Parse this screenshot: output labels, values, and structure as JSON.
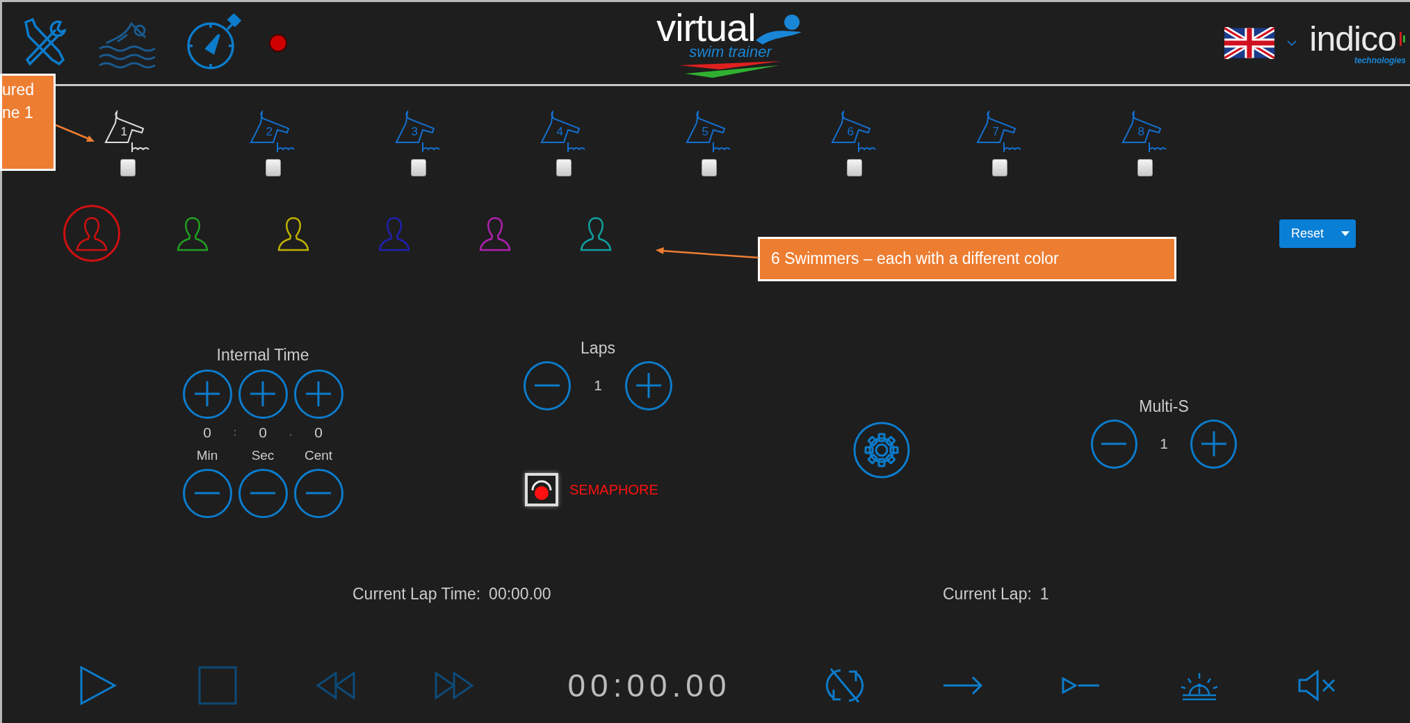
{
  "header": {
    "recording": true,
    "logo": {
      "word": "virtual",
      "tagline": "swim trainer"
    },
    "brand": {
      "name": "indico",
      "sub": "technologies"
    }
  },
  "lanes": [
    {
      "number": "1",
      "selected": true,
      "checked": false
    },
    {
      "number": "2",
      "selected": false,
      "checked": false
    },
    {
      "number": "3",
      "selected": false,
      "checked": false
    },
    {
      "number": "4",
      "selected": false,
      "checked": false
    },
    {
      "number": "5",
      "selected": false,
      "checked": false
    },
    {
      "number": "6",
      "selected": false,
      "checked": false
    },
    {
      "number": "7",
      "selected": false,
      "checked": false
    },
    {
      "number": "8",
      "selected": false,
      "checked": false
    }
  ],
  "swimmers": [
    {
      "color": "#d01010",
      "selected": true
    },
    {
      "color": "#20a020",
      "selected": false
    },
    {
      "color": "#c0b000",
      "selected": false
    },
    {
      "color": "#2020b0",
      "selected": false
    },
    {
      "color": "#b020b0",
      "selected": false
    },
    {
      "color": "#10a0a0",
      "selected": false
    }
  ],
  "reset_button": {
    "label": "Reset"
  },
  "internal_time": {
    "title": "Internal Time",
    "fields": [
      {
        "value": "0",
        "label": "Min"
      },
      {
        "value": "0",
        "label": "Sec"
      },
      {
        "value": "0",
        "label": "Cent"
      }
    ],
    "separators": [
      ":",
      "."
    ]
  },
  "laps": {
    "title": "Laps",
    "value": "1"
  },
  "semaphore": {
    "label": "SEMAPHORE",
    "on": true
  },
  "multi_s": {
    "title": "Multi-S",
    "value": "1"
  },
  "current_lap_time": {
    "label": "Current Lap Time:",
    "value": "00:00.00"
  },
  "current_lap": {
    "label": "Current Lap:",
    "value": "1"
  },
  "transport": [
    {
      "kind": "play",
      "disabled": false
    },
    {
      "kind": "stop",
      "disabled": true
    },
    {
      "kind": "rewind",
      "disabled": true
    },
    {
      "kind": "forward",
      "disabled": true
    },
    {
      "kind": "time",
      "text": "00:00.00"
    },
    {
      "kind": "sync",
      "disabled": false
    },
    {
      "kind": "next",
      "disabled": false
    },
    {
      "kind": "step",
      "disabled": false
    },
    {
      "kind": "alarm",
      "disabled": false
    },
    {
      "kind": "mute",
      "disabled": false
    }
  ],
  "annotations": [
    {
      "lines": [
        "ured",
        "ne 1"
      ]
    },
    {
      "lines": [
        "6 Swimmers – each with a different color"
      ]
    }
  ]
}
